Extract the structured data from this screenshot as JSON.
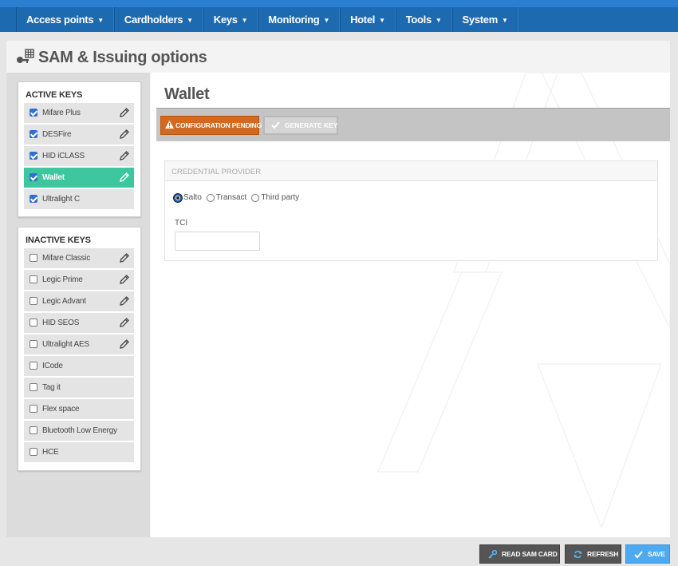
{
  "nav": {
    "items": [
      {
        "label": "Access points",
        "caret": "⌄"
      },
      {
        "label": "Cardholders",
        "caret": "⌄"
      },
      {
        "label": "Keys",
        "caret": "⌄"
      },
      {
        "label": "Monitoring",
        "caret": "⌄"
      },
      {
        "label": "Hotel",
        "caret": "⌄"
      },
      {
        "label": "Tools",
        "caret": "⌄"
      },
      {
        "label": "System",
        "caret": "⌄"
      }
    ]
  },
  "page": {
    "title": "SAM & Issuing options",
    "icon": "key-grid-icon"
  },
  "sidebar": {
    "active_heading": "ACTIVE KEYS",
    "active_keys": [
      {
        "label": "Mifare Plus",
        "checked": true,
        "editable": true,
        "selected": false
      },
      {
        "label": "DESFire",
        "checked": true,
        "editable": true,
        "selected": false
      },
      {
        "label": "HID iCLASS",
        "checked": true,
        "editable": true,
        "selected": false
      },
      {
        "label": "Wallet",
        "checked": true,
        "editable": true,
        "selected": true
      },
      {
        "label": "Ultralight C",
        "checked": true,
        "editable": false,
        "selected": false
      }
    ],
    "inactive_heading": "INACTIVE KEYS",
    "inactive_keys": [
      {
        "label": "Mifare Classic",
        "checked": false,
        "editable": true
      },
      {
        "label": "Legic Prime",
        "checked": false,
        "editable": true
      },
      {
        "label": "Legic Advant",
        "checked": false,
        "editable": true
      },
      {
        "label": "HID SEOS",
        "checked": false,
        "editable": true
      },
      {
        "label": "Ultralight AES",
        "checked": false,
        "editable": true
      },
      {
        "label": "ICode",
        "checked": false,
        "editable": false
      },
      {
        "label": "Tag it",
        "checked": false,
        "editable": false
      },
      {
        "label": "Flex space",
        "checked": false,
        "editable": false
      },
      {
        "label": "Bluetooth Low Energy",
        "checked": false,
        "editable": false
      },
      {
        "label": "HCE",
        "checked": false,
        "editable": false
      }
    ]
  },
  "main": {
    "title": "Wallet",
    "toolbar": {
      "pending_label": "CONFIGURATION PENDING",
      "generate_label": "GENERATE KEY"
    },
    "credential": {
      "heading": "CREDENTIAL PROVIDER",
      "options": [
        {
          "label": "Salto",
          "selected": true
        },
        {
          "label": "Transact",
          "selected": false
        },
        {
          "label": "Third party",
          "selected": false
        }
      ],
      "tci_label": "TCI",
      "tci_value": ""
    }
  },
  "footer": {
    "read_label": "READ SAM CARD",
    "refresh_label": "REFRESH",
    "save_label": "SAVE"
  },
  "colors": {
    "nav": "#1e6ab0",
    "selected_key": "#3ec69e",
    "pending": "#d2691e",
    "save": "#4eaaf0"
  }
}
